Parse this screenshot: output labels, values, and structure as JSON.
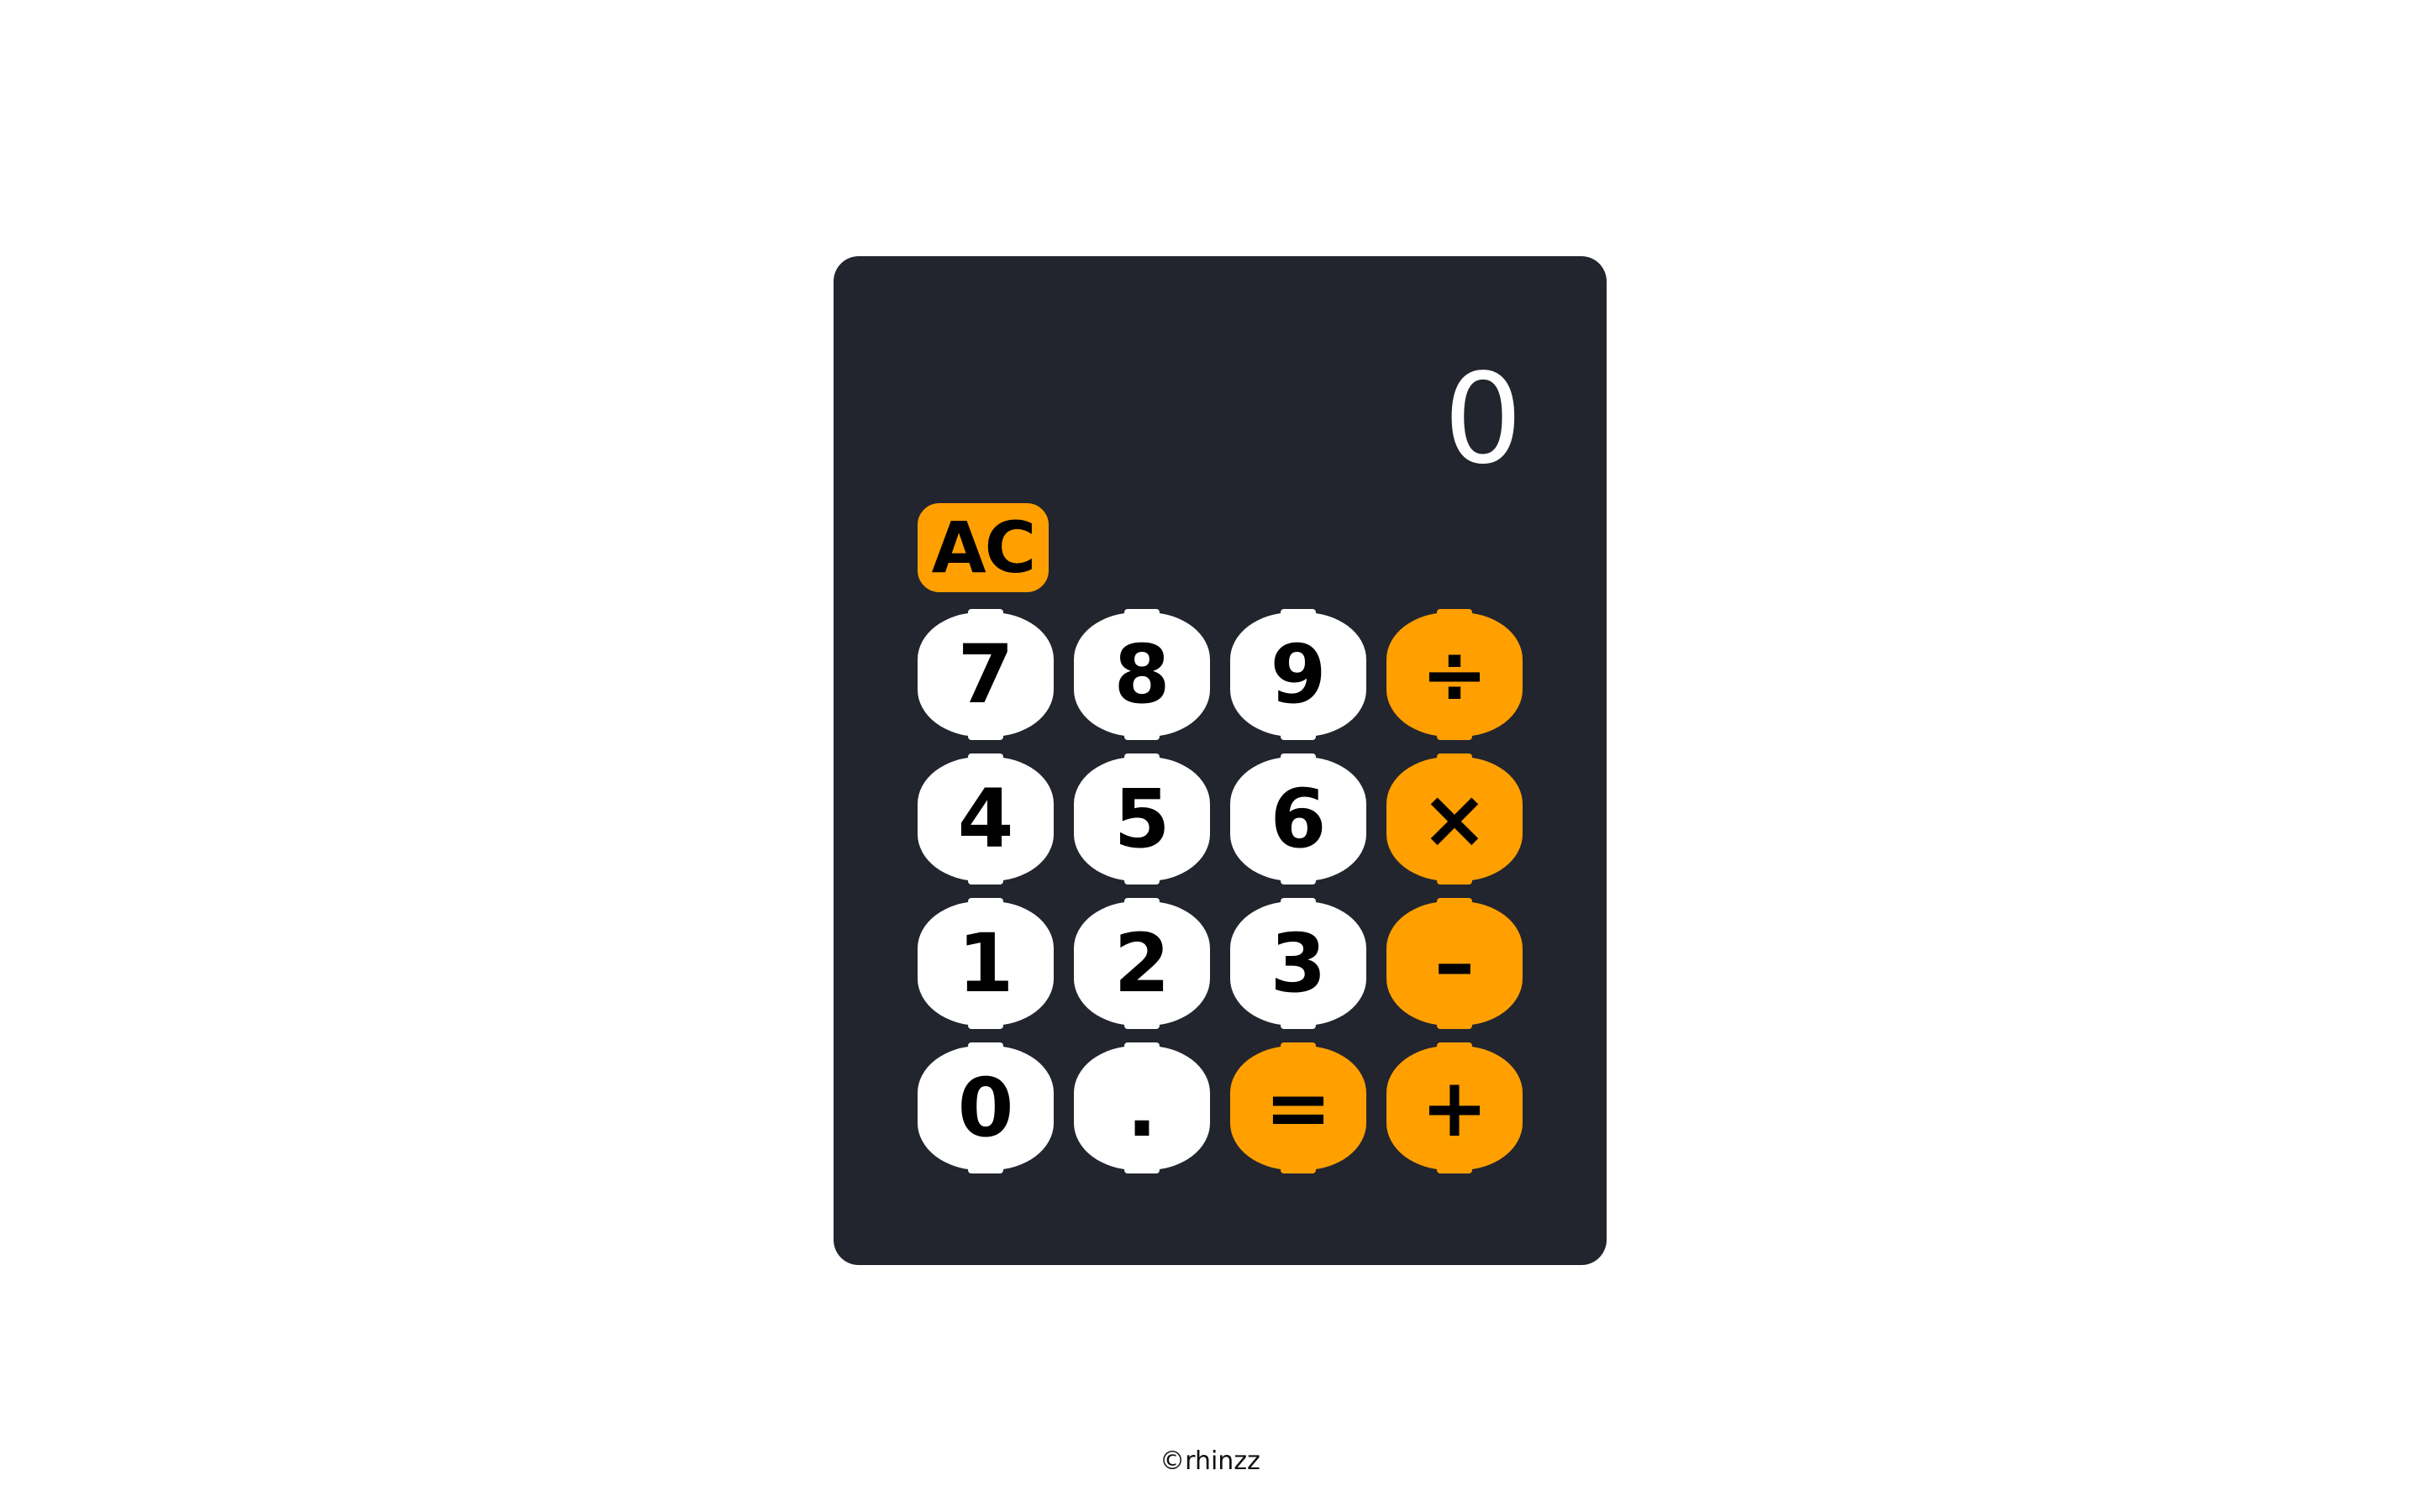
{
  "calculator": {
    "display": "0",
    "clear_label": "AC",
    "keys": [
      {
        "label": "7",
        "kind": "num",
        "name": "key-7"
      },
      {
        "label": "8",
        "kind": "num",
        "name": "key-8"
      },
      {
        "label": "9",
        "kind": "num",
        "name": "key-9"
      },
      {
        "label": "÷",
        "kind": "op",
        "name": "divide-key"
      },
      {
        "label": "4",
        "kind": "num",
        "name": "key-4"
      },
      {
        "label": "5",
        "kind": "num",
        "name": "key-5"
      },
      {
        "label": "6",
        "kind": "num",
        "name": "key-6"
      },
      {
        "label": "×",
        "kind": "op",
        "name": "multiply-key"
      },
      {
        "label": "1",
        "kind": "num",
        "name": "key-1"
      },
      {
        "label": "2",
        "kind": "num",
        "name": "key-2"
      },
      {
        "label": "3",
        "kind": "num",
        "name": "key-3"
      },
      {
        "label": "–",
        "kind": "op",
        "name": "subtract-key"
      },
      {
        "label": "0",
        "kind": "num",
        "name": "key-0"
      },
      {
        "label": ".",
        "kind": "num",
        "name": "decimal-key"
      },
      {
        "label": "=",
        "kind": "op",
        "name": "equals-key"
      },
      {
        "label": "+",
        "kind": "op",
        "name": "add-key"
      }
    ]
  },
  "footer": {
    "credit": "©rhinzz"
  },
  "colors": {
    "body_bg": "#ffffff",
    "calculator_bg": "#22252d",
    "operator_orange": "#ff9f00",
    "number_key_white": "#ffffff",
    "display_text": "#ffffff"
  }
}
